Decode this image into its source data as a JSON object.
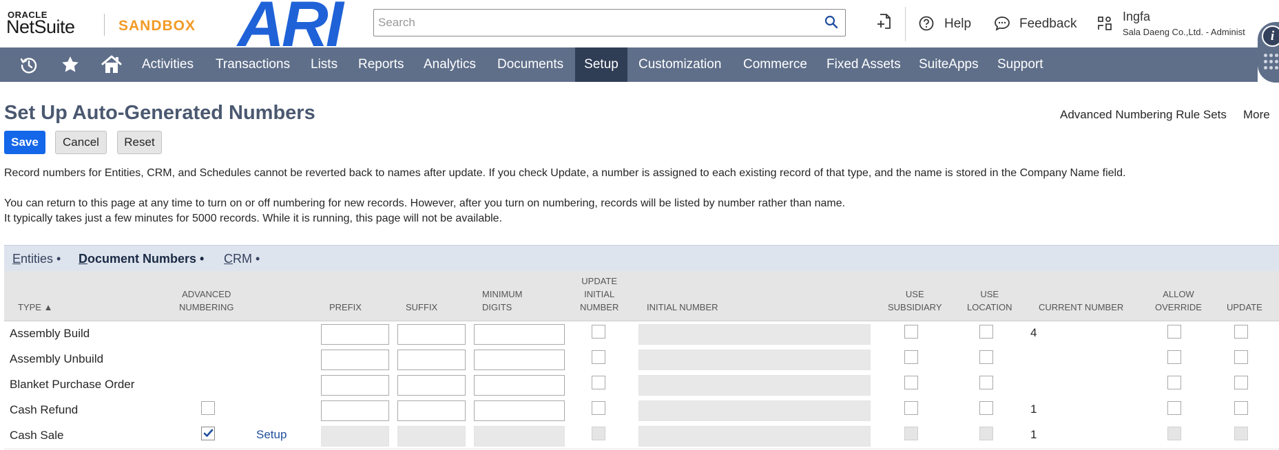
{
  "header": {
    "logo_oracle": "ORACLE",
    "logo_netsuite": "NetSuite",
    "environment": "SANDBOX",
    "brand_logo": "ARI",
    "search_placeholder": "Search",
    "help_label": "Help",
    "feedback_label": "Feedback",
    "user_name": "Ingfa",
    "user_company": "Sala Daeng Co.,Ltd. - Administ",
    "info_label": "i"
  },
  "nav": {
    "icons": [
      "recent-records-icon",
      "favorites-star-icon",
      "home-icon"
    ],
    "items": [
      "Activities",
      "Transactions",
      "Lists",
      "Reports",
      "Analytics",
      "Documents",
      "Setup",
      "Customization",
      "Commerce",
      "Fixed Assets",
      "SuiteApps",
      "Support"
    ],
    "active": "Setup"
  },
  "page": {
    "title": "Set Up Auto-Generated Numbers",
    "links": [
      "Advanced Numbering Rule Sets",
      "More"
    ],
    "buttons": {
      "save": "Save",
      "cancel": "Cancel",
      "reset": "Reset"
    },
    "message1": "Record numbers for Entities, CRM, and Schedules cannot be reverted back to names after update. If you check Update, a number is assigned to each existing record of that type, and the name is stored in the Company Name field.",
    "message2": "You can return to this page at any time to turn on or off numbering for new records. However, after you turn on numbering, records will be listed by number rather than name.",
    "message3": "It typically takes just a few minutes for 5000 records. While it is running, this page will not be available."
  },
  "subtabs": [
    {
      "label": "Entities",
      "underline": "E",
      "rest": "ntities",
      "dot": " •"
    },
    {
      "label": "Document Numbers",
      "underline": "D",
      "rest": "ocument Numbers",
      "dot": " •"
    },
    {
      "label": "CRM",
      "underline": "C",
      "rest": "RM",
      "dot": " •"
    }
  ],
  "active_subtab": "Document Numbers",
  "table": {
    "headers": {
      "type": "TYPE ▲",
      "advanced_numbering_1": "ADVANCED",
      "advanced_numbering_2": "NUMBERING",
      "prefix": "PREFIX",
      "suffix": "SUFFIX",
      "min_digits_1": "MINIMUM",
      "min_digits_2": "DIGITS",
      "update_initial_1": "UPDATE",
      "update_initial_2": "INITIAL",
      "update_initial_3": "NUMBER",
      "initial_number": "INITIAL NUMBER",
      "use_subsidiary_1": "USE",
      "use_subsidiary_2": "SUBSIDIARY",
      "use_location_1": "USE",
      "use_location_2": "LOCATION",
      "current_number": "CURRENT NUMBER",
      "allow_override_1": "ALLOW",
      "allow_override_2": "OVERRIDE",
      "update": "UPDATE"
    },
    "rows": [
      {
        "type": "Assembly Build",
        "current_number": "4",
        "advanced": null,
        "setup_link": ""
      },
      {
        "type": "Assembly Unbuild",
        "current_number": "",
        "advanced": null,
        "setup_link": ""
      },
      {
        "type": "Blanket Purchase Order",
        "current_number": "",
        "advanced": null,
        "setup_link": ""
      },
      {
        "type": "Cash Refund",
        "current_number": "1",
        "advanced": false,
        "setup_link": ""
      },
      {
        "type": "Cash Sale",
        "current_number": "1",
        "advanced": true,
        "setup_link": "Setup"
      }
    ]
  }
}
